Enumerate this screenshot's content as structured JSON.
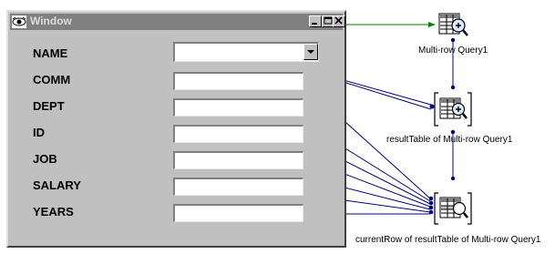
{
  "window": {
    "title": "Window",
    "fields": [
      {
        "label": "NAME",
        "value": ""
      },
      {
        "label": "COMM",
        "value": ""
      },
      {
        "label": "DEPT",
        "value": ""
      },
      {
        "label": "ID",
        "value": ""
      },
      {
        "label": "JOB",
        "value": ""
      },
      {
        "label": "SALARY",
        "value": ""
      },
      {
        "label": "YEARS",
        "value": ""
      }
    ]
  },
  "nodes": {
    "query": {
      "label": "Multi-row Query1"
    },
    "result_table": {
      "label": "resultTable of Multi-row Query1"
    },
    "current_row": {
      "label": "currentRow of resultTable of Multi-row Query1"
    }
  },
  "colors": {
    "connector_green": "#008000",
    "connector_navy": "#000080",
    "window_face": "#c0c0c0",
    "titlebar_inactive": "#808080"
  }
}
